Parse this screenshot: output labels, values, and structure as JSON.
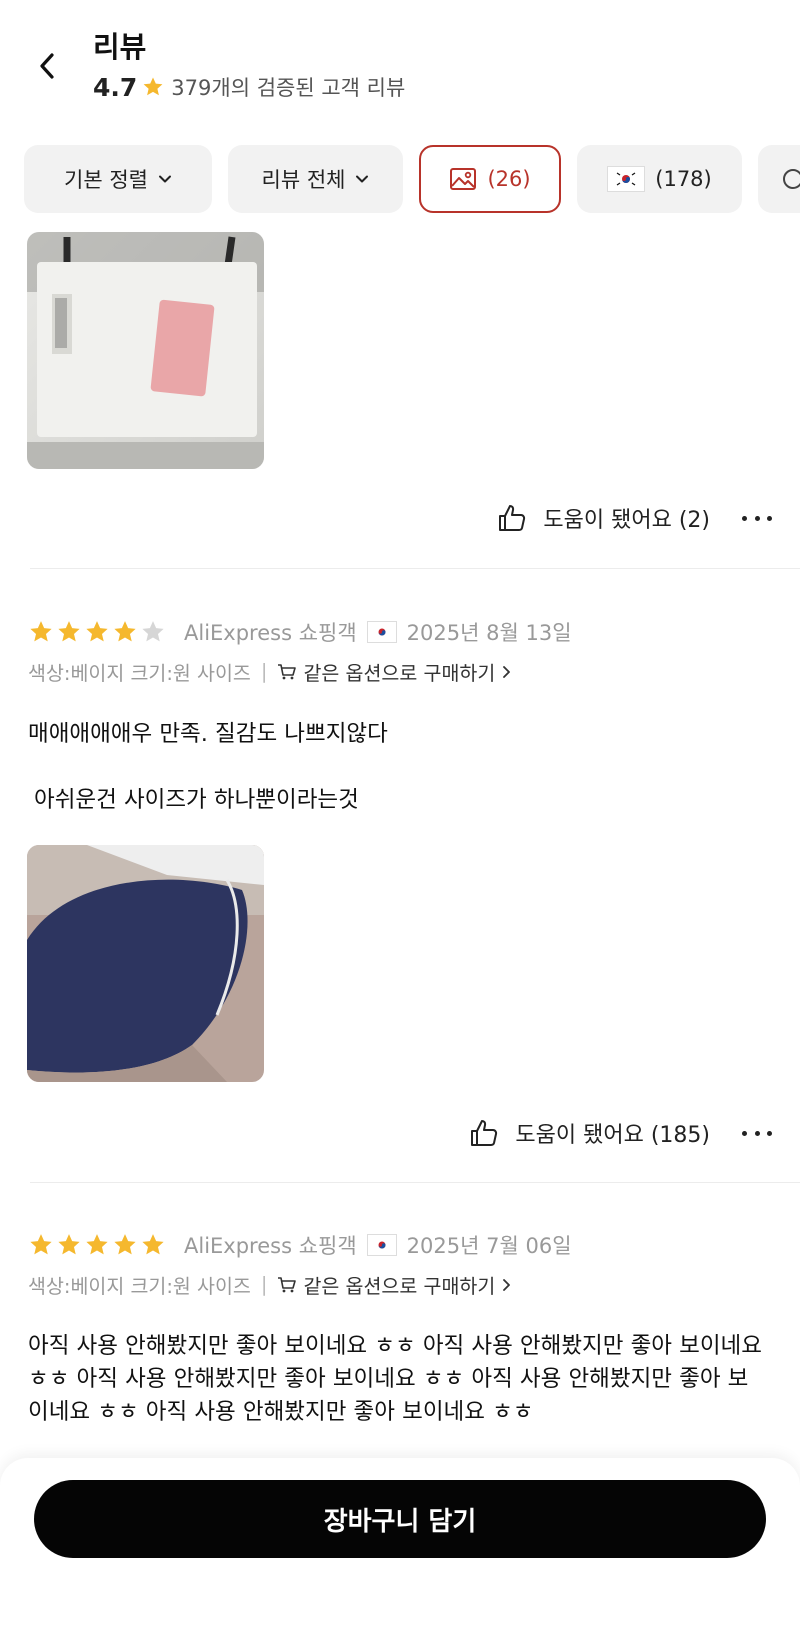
{
  "header": {
    "title": "리뷰",
    "rating": "4.7",
    "review_count_text": "379개의 검증된 고객 리뷰"
  },
  "filters": {
    "sort_label": "기본 정렬",
    "review_filter_label": "리뷰 전체",
    "photo_count": "(26)",
    "country_count": "(178)"
  },
  "reviews": [
    {
      "helpful_label": "도움이 됐어요 (2)"
    },
    {
      "stars": 4,
      "reviewer": "AliExpress 쇼핑객",
      "date": "2025년 8월 13일",
      "option": "색상:베이지 크기:원 사이즈",
      "same_option_label": "같은 옵션으로 구매하기",
      "text_line1": "매애애애애우 만족. 질감도 나쁘지않다",
      "text_line2": "아쉬운건 사이즈가 하나뿐이라는것",
      "helpful_label": "도움이 됐어요 (185)"
    },
    {
      "stars": 5,
      "reviewer": "AliExpress 쇼핑객",
      "date": "2025년 7월 06일",
      "option": "색상:베이지 크기:원 사이즈",
      "same_option_label": "같은 옵션으로 구매하기",
      "text": "아직 사용 안해봤지만 좋아 보이네요 ㅎㅎ 아직 사용 안해봤지만 좋아 보이네요 ㅎㅎ 아직 사용 안해봤지만 좋아 보이네요 ㅎㅎ 아직 사용 안해봤지만 좋아 보이네요 ㅎㅎ 아직 사용 안해봤지만 좋아 보이네요 ㅎㅎ"
    }
  ],
  "bottom": {
    "cart_label": "장바구니 담기"
  },
  "colors": {
    "accent": "#b8332a",
    "star": "#f5b82e",
    "star_empty": "#d6d6d6"
  }
}
